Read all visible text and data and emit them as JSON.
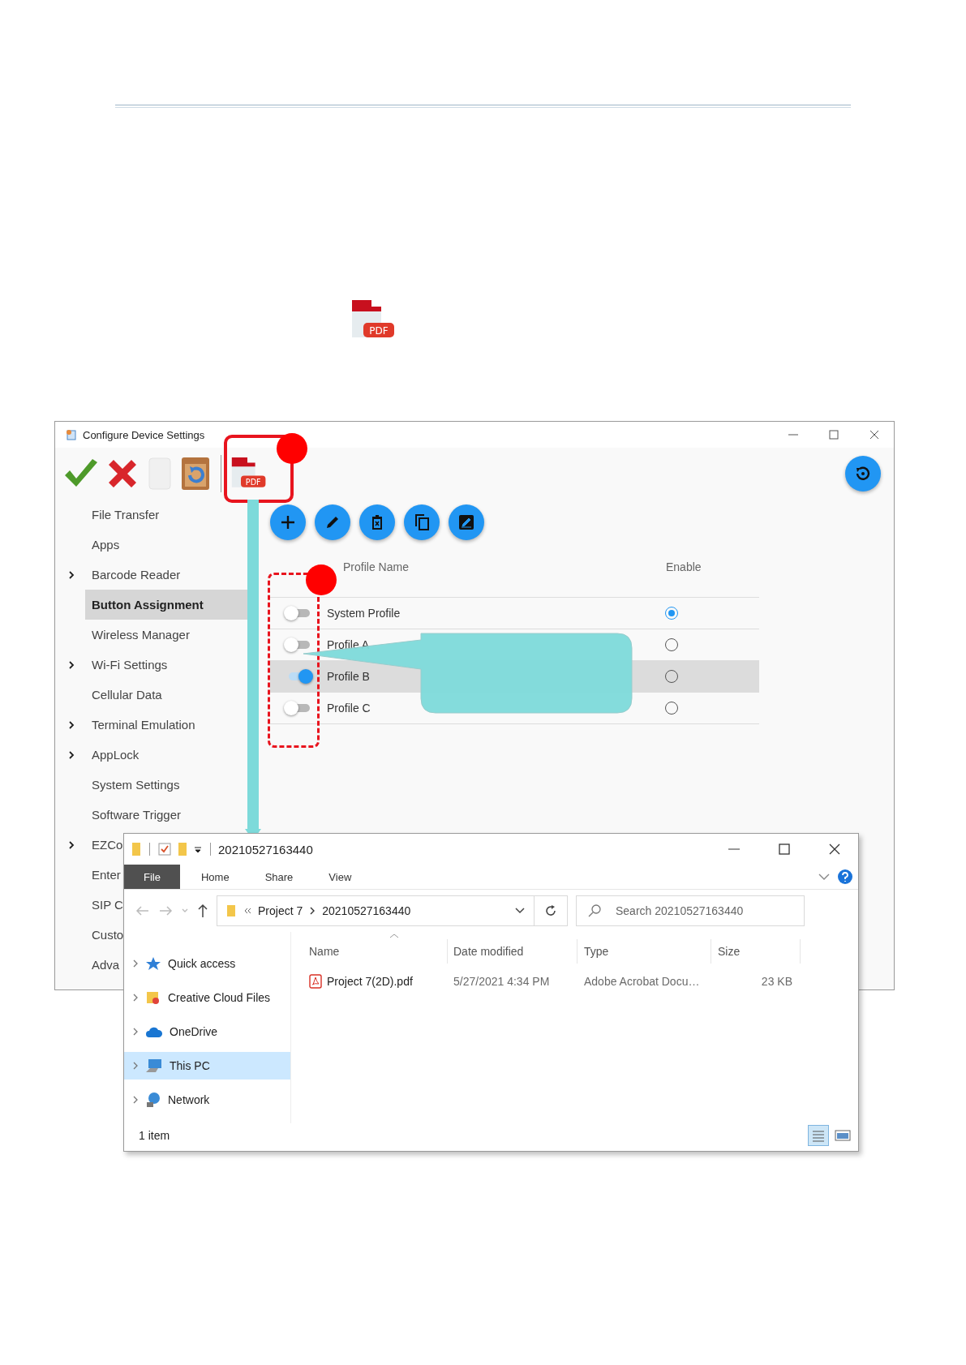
{
  "doc_icon": {
    "label": "PDF"
  },
  "config_window": {
    "title": "Configure Device Settings",
    "pdf_label": "PDF",
    "sidebar": [
      {
        "label": "File Transfer",
        "expandable": false,
        "selected": false
      },
      {
        "label": "Apps",
        "expandable": false,
        "selected": false
      },
      {
        "label": "Barcode Reader",
        "expandable": true,
        "selected": false
      },
      {
        "label": "Button Assignment",
        "expandable": false,
        "selected": true
      },
      {
        "label": "Wireless Manager",
        "expandable": false,
        "selected": false
      },
      {
        "label": "Wi-Fi Settings",
        "expandable": true,
        "selected": false
      },
      {
        "label": "Cellular Data",
        "expandable": false,
        "selected": false
      },
      {
        "label": "Terminal Emulation",
        "expandable": true,
        "selected": false
      },
      {
        "label": "AppLock",
        "expandable": true,
        "selected": false
      },
      {
        "label": "System Settings",
        "expandable": false,
        "selected": false
      },
      {
        "label": "Software Trigger",
        "expandable": false,
        "selected": false
      },
      {
        "label": "EZCo",
        "expandable": true,
        "selected": false
      },
      {
        "label": "Enter",
        "expandable": false,
        "selected": false
      },
      {
        "label": "SIP C",
        "expandable": false,
        "selected": false
      },
      {
        "label": "Custo",
        "expandable": false,
        "selected": false
      },
      {
        "label": "Adva",
        "expandable": false,
        "selected": false
      }
    ],
    "columns": [
      "Profile Name",
      "Enable"
    ],
    "profiles": [
      {
        "name": "System Profile",
        "on": false,
        "enabled": true,
        "selected": false
      },
      {
        "name": "Profile A",
        "on": false,
        "enabled": false,
        "selected": false
      },
      {
        "name": "Profile B",
        "on": true,
        "enabled": false,
        "selected": true
      },
      {
        "name": "Profile C",
        "on": false,
        "enabled": false,
        "selected": false
      }
    ]
  },
  "explorer": {
    "title": "20210527163440",
    "ribbon_tabs": [
      {
        "label": "File",
        "selected": true
      },
      {
        "label": "Home",
        "selected": false
      },
      {
        "label": "Share",
        "selected": false
      },
      {
        "label": "View",
        "selected": false
      }
    ],
    "path": [
      "Project 7",
      "20210527163440"
    ],
    "search": {
      "placeholder": "Search 20210527163440"
    },
    "nav": [
      {
        "label": "Quick access",
        "kind": "star",
        "selected": false
      },
      {
        "label": "Creative Cloud Files",
        "kind": "cloud-folder",
        "selected": false
      },
      {
        "label": "OneDrive",
        "kind": "cloud",
        "selected": false
      },
      {
        "label": "This PC",
        "kind": "pc",
        "selected": true
      },
      {
        "label": "Network",
        "kind": "network",
        "selected": false
      }
    ],
    "columns": [
      "Name",
      "Date modified",
      "Type",
      "Size"
    ],
    "files": [
      {
        "name": "Project 7(2D).pdf",
        "date": "5/27/2021 4:34 PM",
        "type": "Adobe Acrobat Docu…",
        "size": "23 KB"
      }
    ],
    "status": "1 item"
  }
}
